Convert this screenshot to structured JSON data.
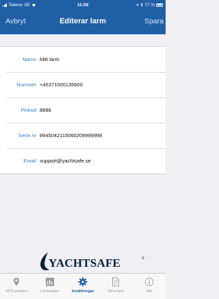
{
  "status_bar": {
    "carrier": "Telenor SE",
    "time": "11:08",
    "battery": "77 %"
  },
  "nav": {
    "cancel_label": "Avbryt",
    "title": "Editerar larm",
    "save_label": "Spara"
  },
  "form": {
    "fields": [
      {
        "label": "Namn",
        "value": "Mitt larm"
      },
      {
        "label": "Nummer",
        "value": "+45371000135600"
      },
      {
        "label": "Pinkod",
        "value": "8888"
      },
      {
        "label": "Serie.nr",
        "value": "8945042115060209999999"
      },
      {
        "label": "Email",
        "value": "support@yachtsafe.se"
      }
    ]
  },
  "logo": {
    "text": "YACHTSAFE",
    "reg": "®"
  },
  "tabs": [
    {
      "label": "GPS-position",
      "icon": "map-pin-icon",
      "active": false
    },
    {
      "label": "Larmstatus",
      "icon": "bar-chart-icon",
      "active": false
    },
    {
      "label": "Inställningar",
      "icon": "gear-icon",
      "active": true
    },
    {
      "label": "Mina larm",
      "icon": "document-icon",
      "active": false
    },
    {
      "label": "Info",
      "icon": "info-icon",
      "active": false
    }
  ],
  "colors": {
    "primary": "#1f5fa6",
    "label": "#3d7bbf",
    "inactive": "#9a9a9a"
  }
}
